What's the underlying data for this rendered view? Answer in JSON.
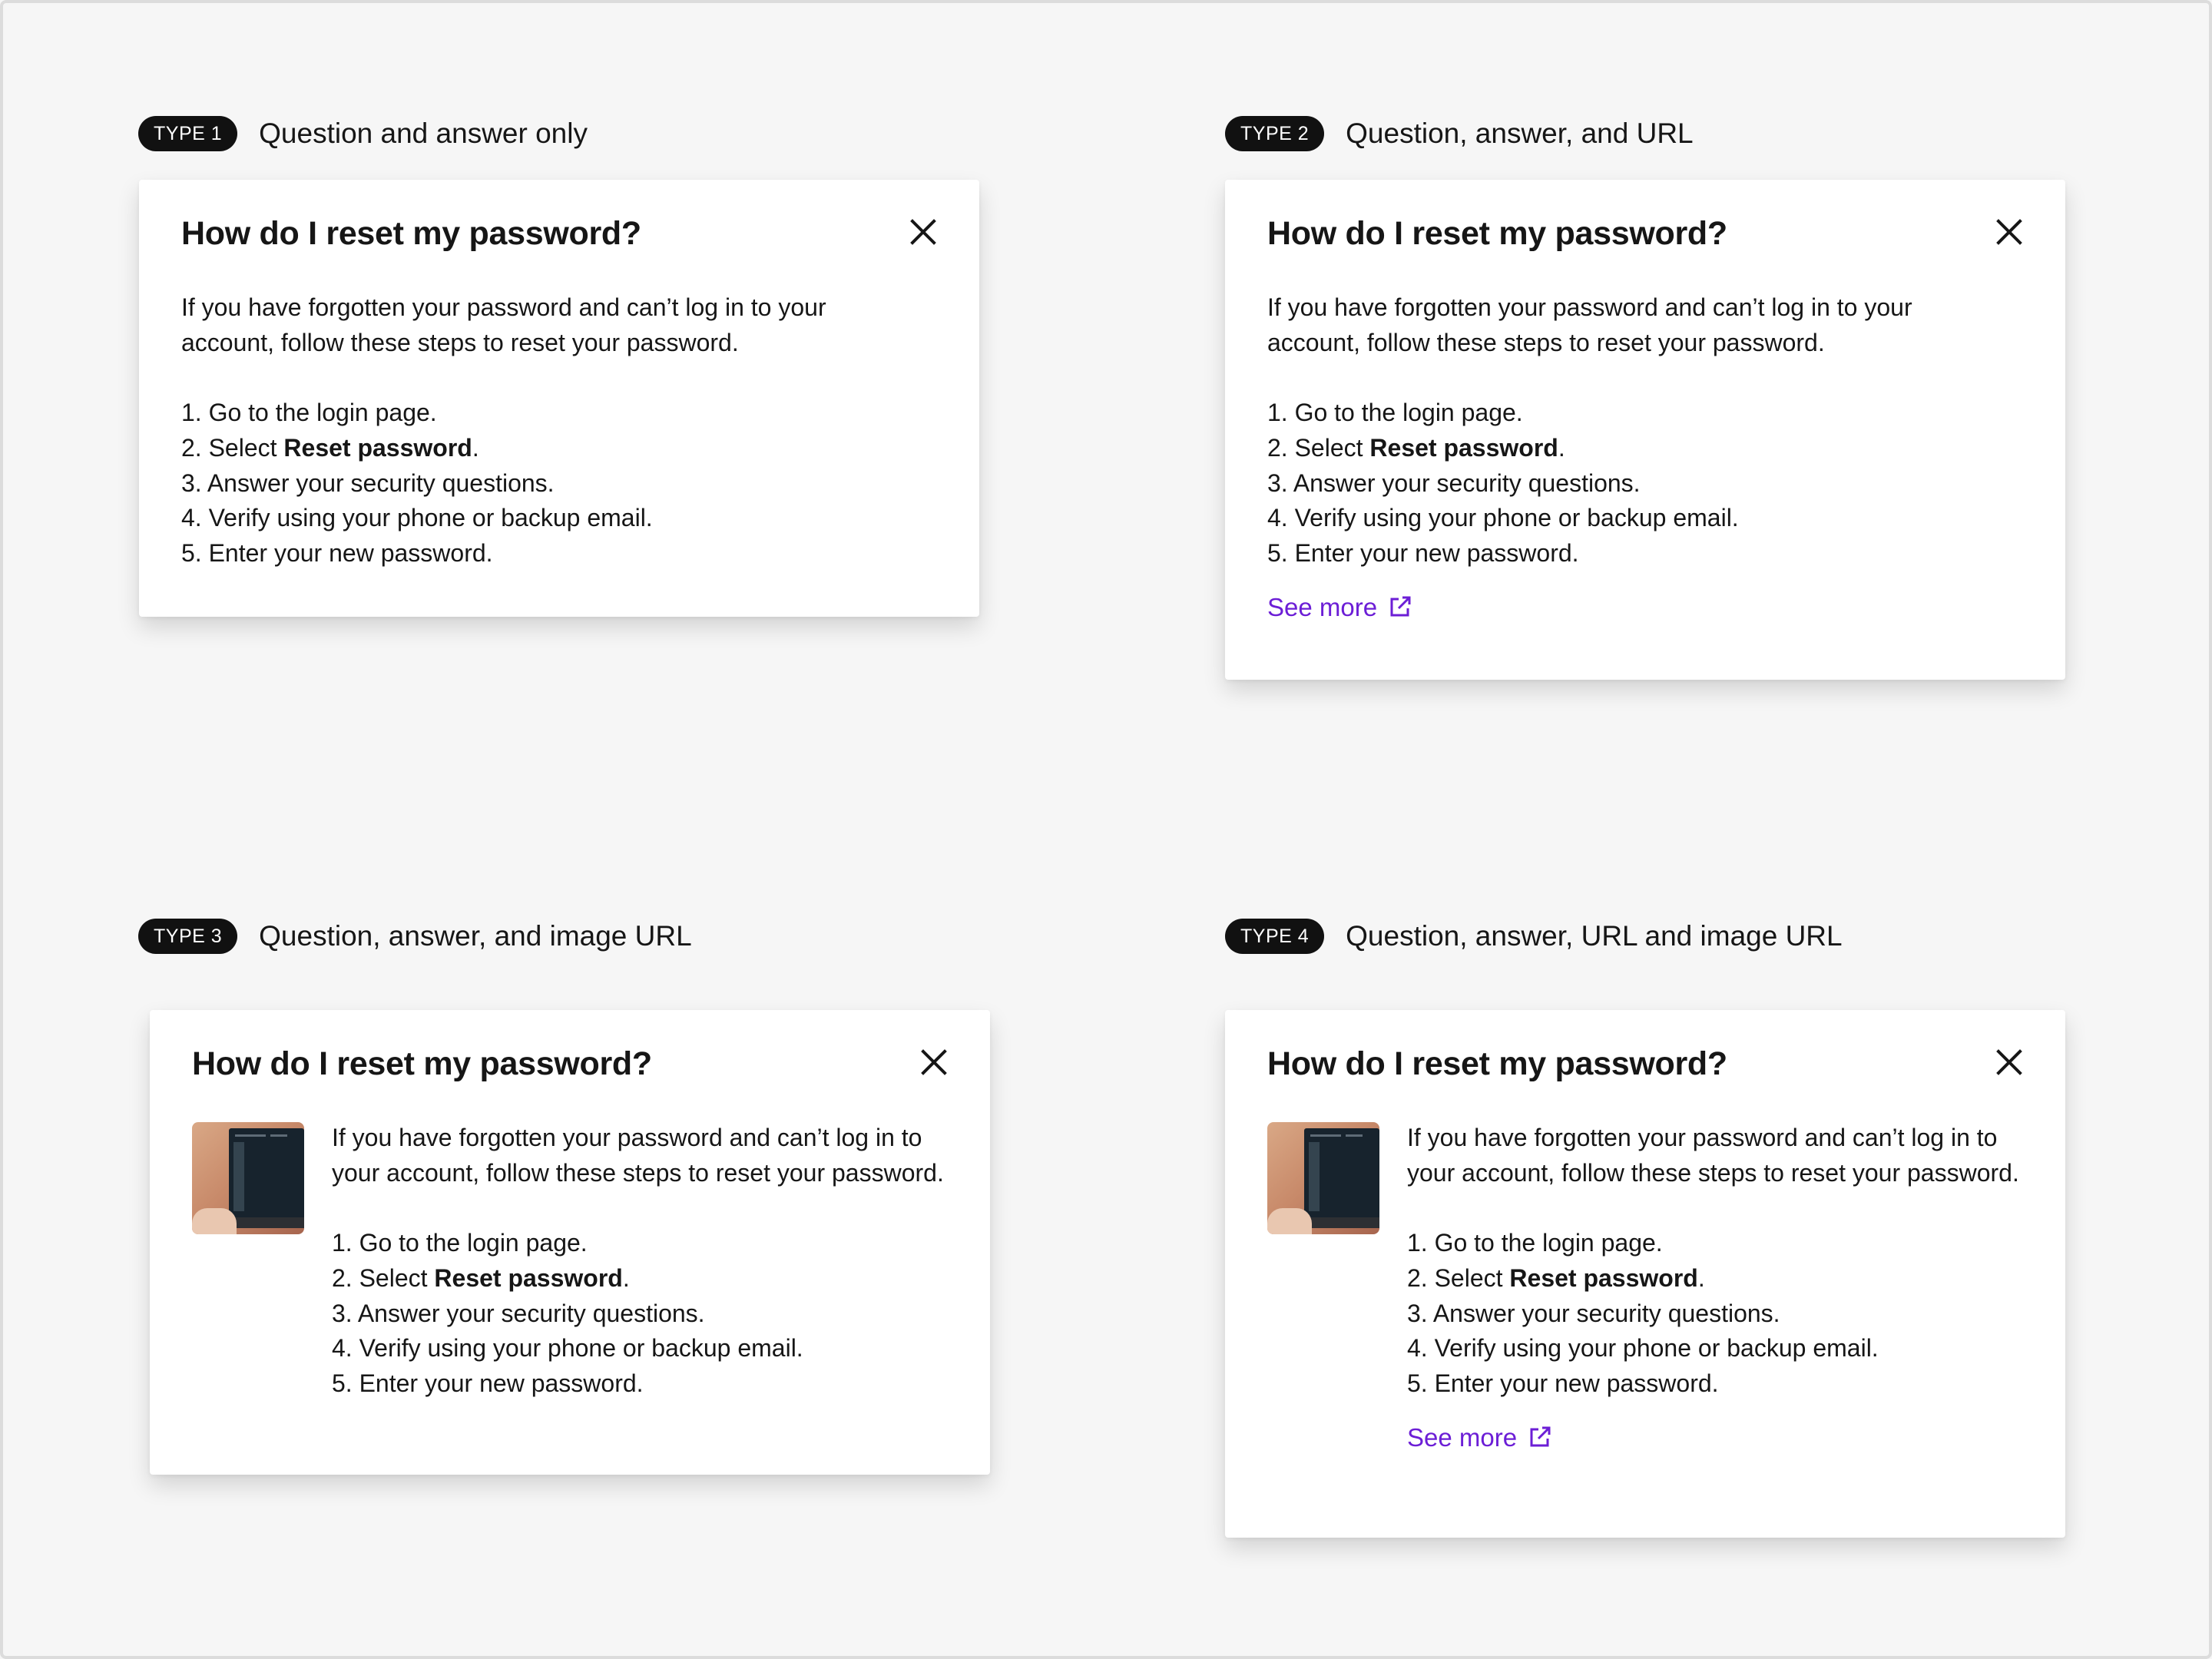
{
  "sections": [
    {
      "badge": "TYPE 1",
      "title": "Question and answer only",
      "card": {
        "heading": "How do I reset my password?",
        "intro": "If you have forgotten your password and can’t log in to  your account, follow these steps to reset your password.",
        "steps": [
          {
            "prefix": "1. Go to the login page.",
            "bold": "",
            "suffix": ""
          },
          {
            "prefix": "2. Select ",
            "bold": "Reset password",
            "suffix": "."
          },
          {
            "prefix": "3. Answer your security questions.",
            "bold": "",
            "suffix": ""
          },
          {
            "prefix": "4. Verify using your phone or backup email.",
            "bold": "",
            "suffix": ""
          },
          {
            "prefix": "5. Enter your new password.",
            "bold": "",
            "suffix": ""
          }
        ]
      }
    },
    {
      "badge": "TYPE 2",
      "title": "Question, answer, and URL",
      "card": {
        "heading": "How do I reset my password?",
        "intro": "If you have forgotten your password and can’t log in to  your account, follow these steps to reset your password.",
        "steps": [
          {
            "prefix": "1. Go to the login page.",
            "bold": "",
            "suffix": ""
          },
          {
            "prefix": "2. Select ",
            "bold": "Reset password",
            "suffix": "."
          },
          {
            "prefix": "3. Answer your security questions.",
            "bold": "",
            "suffix": ""
          },
          {
            "prefix": "4. Verify using your phone or backup email.",
            "bold": "",
            "suffix": ""
          },
          {
            "prefix": "5. Enter your new password.",
            "bold": "",
            "suffix": ""
          }
        ],
        "link": "See more"
      }
    },
    {
      "badge": "TYPE 3",
      "title": "Question, answer, and image URL",
      "card": {
        "heading": "How do I reset my password?",
        "intro": "If you have forgotten your password and can’t log in to  your account, follow these steps to reset your password.",
        "steps": [
          {
            "prefix": "1. Go to the login page.",
            "bold": "",
            "suffix": ""
          },
          {
            "prefix": "2. Select ",
            "bold": "Reset password",
            "suffix": "."
          },
          {
            "prefix": "3. Answer your security questions.",
            "bold": "",
            "suffix": ""
          },
          {
            "prefix": "4. Verify using your phone or backup email.",
            "bold": "",
            "suffix": ""
          },
          {
            "prefix": "5. Enter your new password.",
            "bold": "",
            "suffix": ""
          }
        ],
        "image": "laptop-thumbnail"
      }
    },
    {
      "badge": "TYPE 4",
      "title": "Question, answer, URL and image URL",
      "card": {
        "heading": "How do I reset my password?",
        "intro": "If you have forgotten your password and can’t log in to  your account, follow these steps to reset your password.",
        "steps": [
          {
            "prefix": "1. Go to the login page.",
            "bold": "",
            "suffix": ""
          },
          {
            "prefix": "2. Select ",
            "bold": "Reset password",
            "suffix": "."
          },
          {
            "prefix": "3. Answer your security questions.",
            "bold": "",
            "suffix": ""
          },
          {
            "prefix": "4. Verify using your phone or backup email.",
            "bold": "",
            "suffix": ""
          },
          {
            "prefix": "5. Enter your new password.",
            "bold": "",
            "suffix": ""
          }
        ],
        "image": "laptop-thumbnail",
        "link": "See more"
      }
    }
  ],
  "icons": {
    "close": "close-icon",
    "external_link": "external-link-icon"
  },
  "colors": {
    "background": "#f6f6f6",
    "card": "#ffffff",
    "badge": "#111111",
    "link": "#6c1ed6",
    "text": "#161616"
  }
}
